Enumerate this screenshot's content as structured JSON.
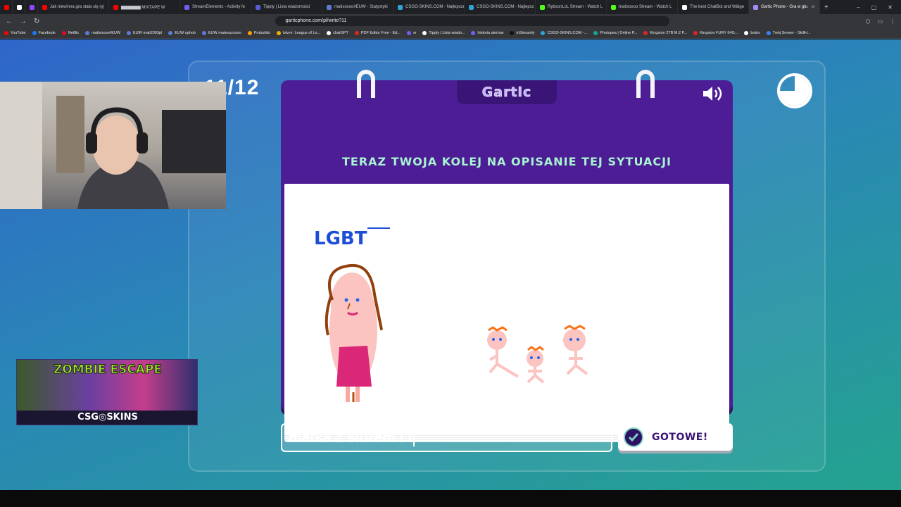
{
  "browser": {
    "tabs": [
      {
        "label": "Jak niewinna gra stała się ryj",
        "color": "#ff0000"
      },
      {
        "label": "▆▆▆▆▆▆ MIXTAPE W",
        "color": "#ff0000"
      },
      {
        "label": "StreamElements - Activity fe",
        "color": "#6e5ff5"
      },
      {
        "label": "Tipply | Lista wiadomości",
        "color": "#5b5bd6"
      },
      {
        "label": "matixoxoo#EUW - Statystyki",
        "color": "#5b7bd6"
      },
      {
        "label": "CSGO-SKINS.COM - Najlepsze",
        "color": "#2fa3d6"
      },
      {
        "label": "CSGO-SKINS.COM - Najlepsz",
        "color": "#2fa3d6"
      },
      {
        "label": "RybsonLoL Stream - Watch L",
        "color": "#53fc18"
      },
      {
        "label": "matixoxoo Stream - Watch L",
        "color": "#53fc18"
      },
      {
        "label": "The best ChatBot and Widge",
        "color": "#ffffff"
      },
      {
        "label": "Gartic Phone - Gra w głu",
        "color": "#a78bfa"
      }
    ],
    "url": "garticphone.com/pl/write?11",
    "bookmarks": [
      {
        "label": "YouTube",
        "color": "#ff0000"
      },
      {
        "label": "Facebook",
        "color": "#1877f2"
      },
      {
        "label": "Netflix",
        "color": "#e50914"
      },
      {
        "label": "matixoxoo#EUW",
        "color": "#5b7bd6"
      },
      {
        "label": "EUW mati2003pl",
        "color": "#5b7bd6"
      },
      {
        "label": "EUW ophob",
        "color": "#5b7bd6"
      },
      {
        "label": "EUW mateuszxoxo",
        "color": "#5b7bd6"
      },
      {
        "label": "Probuilds",
        "color": "#f59e0b"
      },
      {
        "label": "lolvvv: League of Le...",
        "color": "#eab308"
      },
      {
        "label": "chatGPT",
        "color": "#ffffff"
      },
      {
        "label": "PDF Editor Free - Ed...",
        "color": "#dc2626"
      },
      {
        "label": "sr",
        "color": "#6e5ff5"
      },
      {
        "label": "Tipply | Lista wiado...",
        "color": "#ffffff"
      },
      {
        "label": "historia alertow",
        "color": "#6e5ff5"
      },
      {
        "label": "inStreamly",
        "color": "#111111"
      },
      {
        "label": "CSGO-SKINS.COM -...",
        "color": "#2fa3d6"
      },
      {
        "label": "Photopea | Online P...",
        "color": "#18a497"
      },
      {
        "label": "Kingston 2TB M.2 P...",
        "color": "#dc2626"
      },
      {
        "label": "Kingston FURY 64G...",
        "color": "#dc2626"
      },
      {
        "label": "botrix",
        "color": "#ffffff"
      },
      {
        "label": "Twój Serwer - SkillH...",
        "color": "#3b82f6"
      }
    ]
  },
  "game": {
    "logo": "Gartic",
    "round_counter": "11/12",
    "instruction": "TERAZ TWOJA KOLEJ NA OPISANIE TEJ SYTUACJI",
    "drawing_caption": "LGBT",
    "input_value": "matka z siurem i t",
    "done_label": "GOTOWE!",
    "timer_elapsed_fraction": 0.75
  },
  "overlay": {
    "ad_title": "ZOMBIE ESCAPE",
    "ad_brand": "CSG◎SKINS"
  },
  "colors": {
    "panel": "#4c1d95",
    "header_text": "#a7f3d0",
    "accent_dark": "#3b1478"
  }
}
